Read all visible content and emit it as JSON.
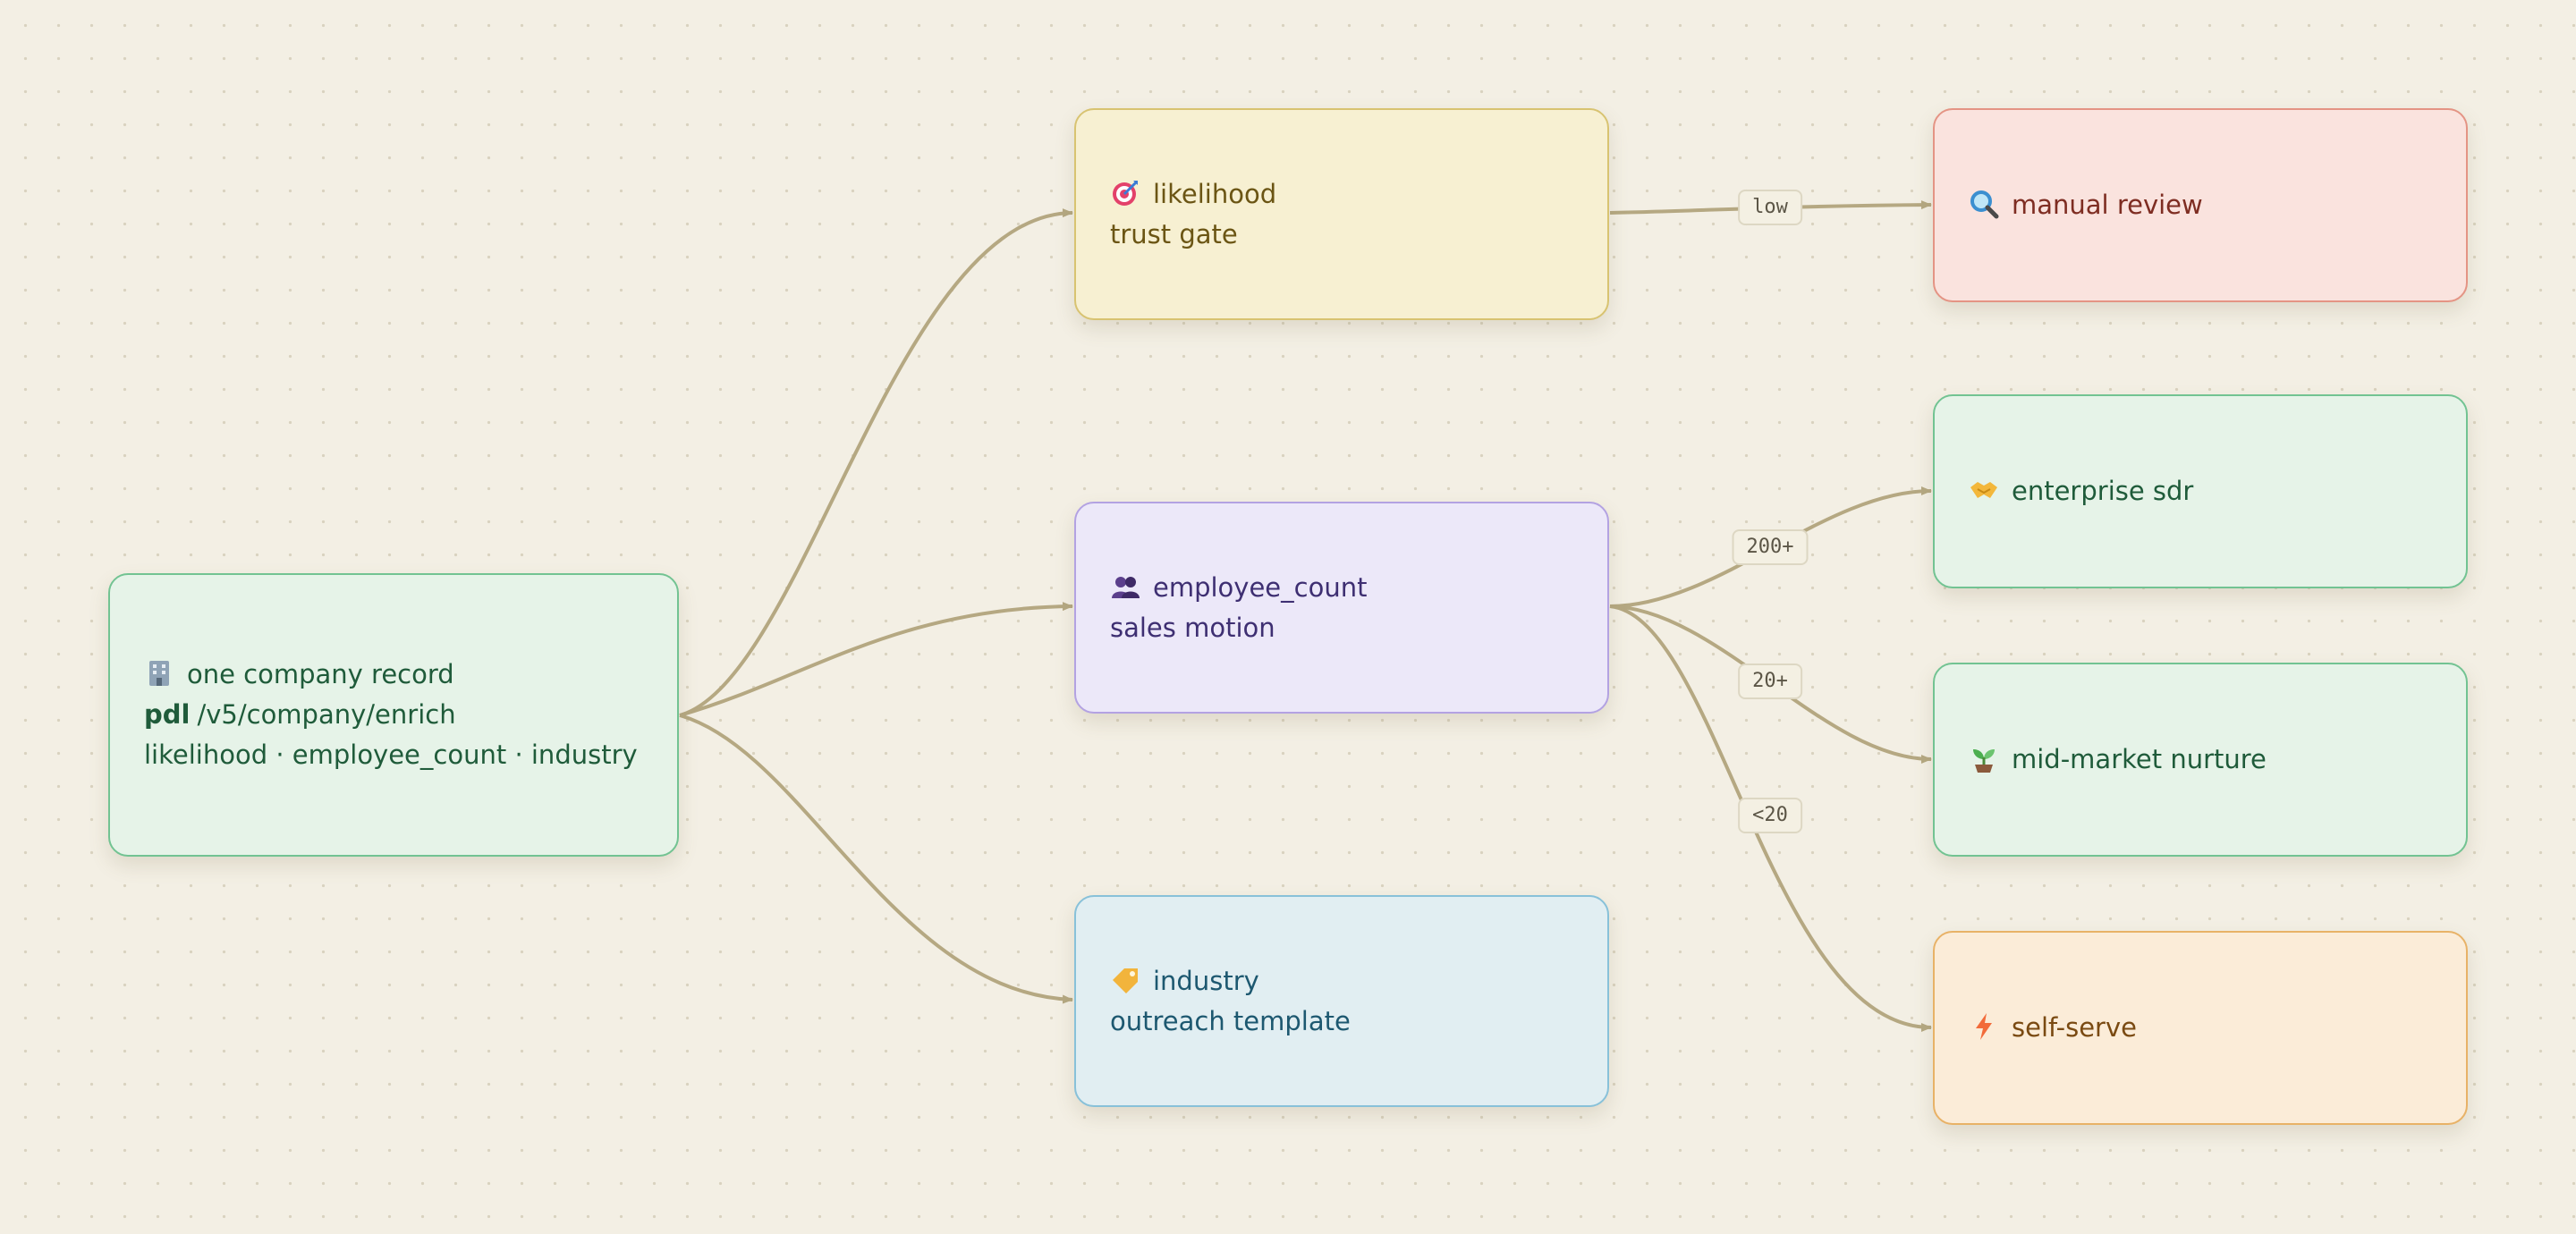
{
  "colors": {
    "background": "#f3efe4",
    "edge": "#b5a882",
    "source_fill": "#e6f3e8",
    "likelihood_fill": "#f7f0d2",
    "employee_fill": "#ece8f9",
    "industry_fill": "#e1eef2",
    "manual_fill": "#fae3de",
    "selfserve_fill": "#fbecd8"
  },
  "nodes": {
    "source": {
      "icon": "office-building-icon",
      "title": "one company record",
      "api_prefix": "pdl",
      "api_path": "/v5/company/enrich",
      "fields": "likelihood · employee_count · industry"
    },
    "likelihood": {
      "icon": "target-icon",
      "title": "likelihood",
      "subtitle": "trust gate"
    },
    "employee_count": {
      "icon": "people-icon",
      "title": "employee_count",
      "subtitle": "sales motion"
    },
    "industry": {
      "icon": "tag-icon",
      "title": "industry",
      "subtitle": "outreach template"
    },
    "manual_review": {
      "icon": "magnifier-icon",
      "title": "manual review"
    },
    "enterprise_sdr": {
      "icon": "handshake-icon",
      "title": "enterprise sdr"
    },
    "mid_market_nurture": {
      "icon": "seedling-icon",
      "title": "mid-market nurture"
    },
    "self_serve": {
      "icon": "lightning-icon",
      "title": "self-serve"
    }
  },
  "edges": [
    {
      "from": "source",
      "to": "likelihood",
      "label": ""
    },
    {
      "from": "source",
      "to": "employee_count",
      "label": ""
    },
    {
      "from": "source",
      "to": "industry",
      "label": ""
    },
    {
      "from": "likelihood",
      "to": "manual_review",
      "label": "low"
    },
    {
      "from": "employee_count",
      "to": "enterprise_sdr",
      "label": "200+"
    },
    {
      "from": "employee_count",
      "to": "mid_market_nurture",
      "label": "20+"
    },
    {
      "from": "employee_count",
      "to": "self_serve",
      "label": "<20"
    }
  ]
}
